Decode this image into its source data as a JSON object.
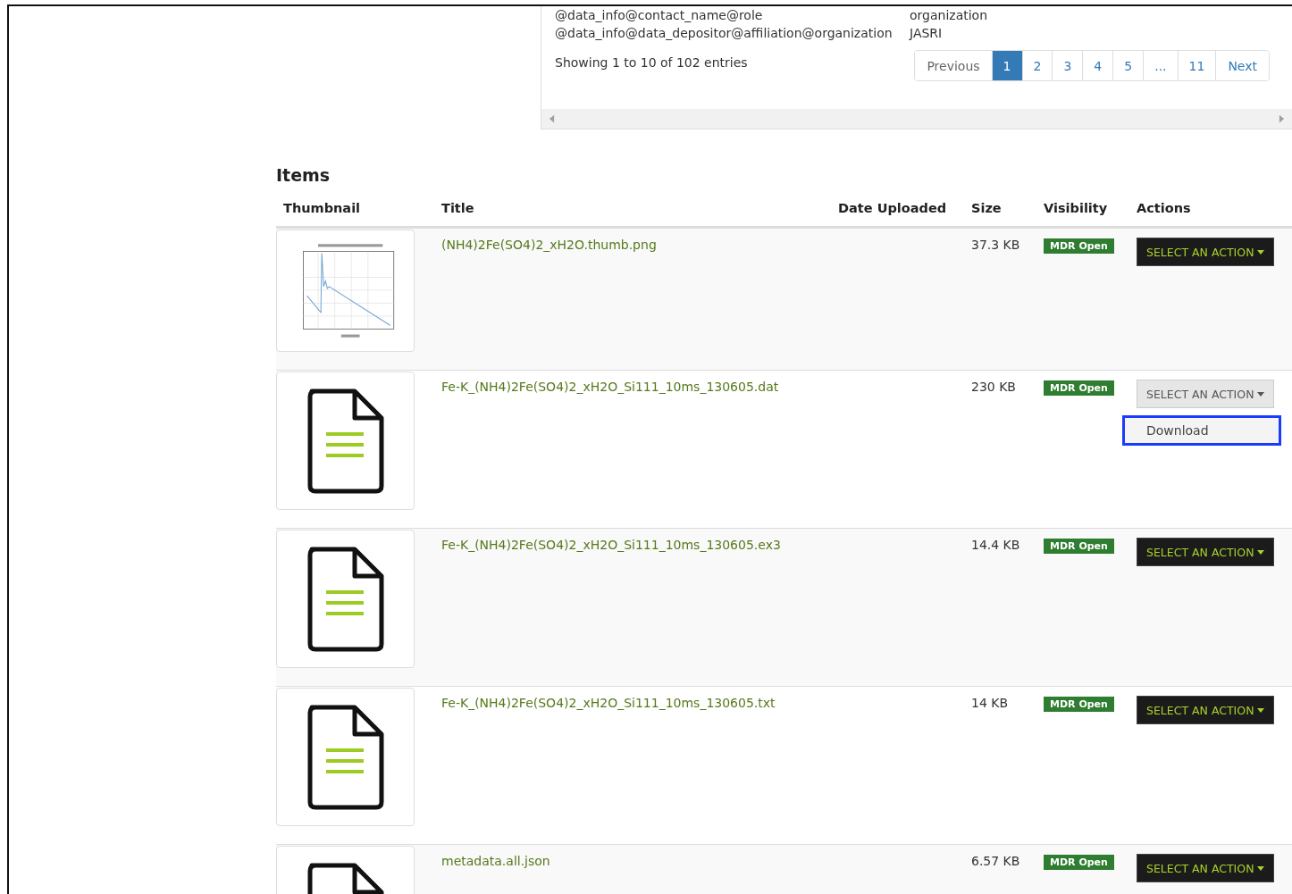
{
  "metadata_rows": [
    {
      "key": "@data_info@contact_name@role",
      "value": "organization"
    },
    {
      "key": "@data_info@data_depositor@affiliation@organization",
      "value": "JASRI"
    }
  ],
  "entries_info": "Showing 1 to 10 of 102 entries",
  "pagination": [
    {
      "label": "Previous",
      "selected": false
    },
    {
      "label": "1",
      "selected": true
    },
    {
      "label": "2",
      "selected": false
    },
    {
      "label": "3",
      "selected": false
    },
    {
      "label": "4",
      "selected": false
    },
    {
      "label": "5",
      "selected": false
    },
    {
      "label": "...",
      "selected": false
    },
    {
      "label": "11",
      "selected": false
    },
    {
      "label": "Next",
      "selected": false
    }
  ],
  "items": {
    "heading": "Items",
    "columns": [
      "Thumbnail",
      "Title",
      "Date Uploaded",
      "Size",
      "Visibility",
      "Actions"
    ],
    "rows": [
      {
        "title": "(NH4)2Fe(SO4)2_xH2O.thumb.png",
        "size": "37.3 KB",
        "visibility": "MDR Open",
        "action": "SELECT AN ACTION",
        "expanded": false
      },
      {
        "thumbnail": {
          "kind": "file"
        },
        "title": "Fe-K_(NH4)2Fe(SO4)2_xH2O_Si111_10ms_130605.dat",
        "size": "230 KB",
        "visibility": "MDR Open",
        "action": "SELECT AN ACTION",
        "expanded": true,
        "menu_items": [
          "Download"
        ]
      },
      {
        "thumbnail": {
          "kind": "file"
        },
        "title": "Fe-K_(NH4)2Fe(SO4)2_xH2O_Si111_10ms_130605.ex3",
        "size": "14.4 KB",
        "visibility": "MDR Open",
        "action": "SELECT AN ACTION",
        "expanded": false
      },
      {
        "thumbnail": {
          "kind": "file"
        },
        "title": "Fe-K_(NH4)2Fe(SO4)2_xH2O_Si111_10ms_130605.txt",
        "size": "14 KB",
        "visibility": "MDR Open",
        "action": "SELECT AN ACTION",
        "expanded": false
      },
      {
        "thumbnail": {
          "kind": "file"
        },
        "title": "metadata.all.json",
        "size": "6.57 KB",
        "visibility": "MDR Open",
        "action": "SELECT AN ACTION",
        "expanded": false
      }
    ]
  }
}
